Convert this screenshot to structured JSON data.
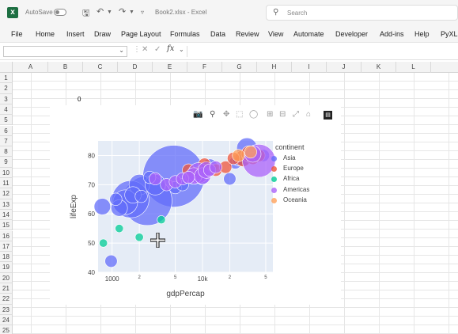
{
  "titlebar": {
    "autosave_label": "AutoSave",
    "toggle_state": "Off",
    "doc_title": "Book2.xlsx  -  Excel",
    "search_placeholder": "Search"
  },
  "ribbon": {
    "tabs": [
      "File",
      "Home",
      "Insert",
      "Draw",
      "Page Layout",
      "Formulas",
      "Data",
      "Review",
      "View",
      "Automate",
      "Developer",
      "Add-ins",
      "Help",
      "PyXLL"
    ]
  },
  "formula_bar": {
    "namebox_value": "",
    "fx_label": "fx",
    "formula_value": ""
  },
  "grid": {
    "columns": [
      "A",
      "B",
      "C",
      "D",
      "E",
      "F",
      "G",
      "H",
      "I",
      "J",
      "K",
      "L"
    ],
    "rows": [
      "1",
      "2",
      "3",
      "4",
      "5",
      "6",
      "7",
      "8",
      "9",
      "10",
      "11",
      "12",
      "13",
      "14",
      "15",
      "16",
      "17",
      "18",
      "19",
      "20",
      "21",
      "22",
      "23",
      "24",
      "25"
    ],
    "cell_B3": "0"
  },
  "modebar_icons": [
    "camera-icon",
    "zoom-icon",
    "pan-icon",
    "box-select-icon",
    "lasso-select-icon",
    "zoom-in-icon",
    "zoom-out-icon",
    "autoscale-icon",
    "reset-axes-icon",
    "plotly-logo-icon"
  ],
  "chart_data": {
    "type": "scatter",
    "xlabel": "gdpPercap",
    "ylabel": "lifeExp",
    "xscale": "log",
    "xlim": [
      700,
      60000
    ],
    "ylim": [
      40,
      85
    ],
    "x_ticks": [
      {
        "value": 1000,
        "label": "1000"
      },
      {
        "value": 2000,
        "label": "2"
      },
      {
        "value": 5000,
        "label": "5"
      },
      {
        "value": 10000,
        "label": "10k"
      },
      {
        "value": 20000,
        "label": "2"
      },
      {
        "value": 50000,
        "label": "5"
      }
    ],
    "y_ticks": [
      40,
      50,
      60,
      70,
      80
    ],
    "legend_title": "continent",
    "legend_position": "right",
    "series": [
      {
        "name": "Asia",
        "color": "#636efa",
        "points": [
          [
            975,
            43.8,
            3
          ],
          [
            780,
            62.5,
            4
          ],
          [
            1100,
            65,
            3
          ],
          [
            1200,
            62,
            4
          ],
          [
            1400,
            64,
            6
          ],
          [
            1600,
            65,
            9
          ],
          [
            1700,
            66.5,
            4
          ],
          [
            2000,
            70,
            5
          ],
          [
            2100,
            66,
            3
          ],
          [
            2450,
            64.5,
            12
          ],
          [
            2600,
            72.5,
            3
          ],
          [
            3000,
            70,
            5
          ],
          [
            4800,
            72.9,
            15
          ],
          [
            5000,
            69,
            3
          ],
          [
            6000,
            70,
            3
          ],
          [
            8000,
            73,
            4
          ],
          [
            10000,
            72,
            3
          ],
          [
            12000,
            76,
            4
          ],
          [
            20000,
            72,
            3
          ],
          [
            23000,
            77.5,
            3
          ],
          [
            25000,
            78.5,
            3
          ],
          [
            28000,
            78.5,
            3
          ],
          [
            31000,
            82.5,
            5
          ],
          [
            40000,
            80,
            3
          ],
          [
            47000,
            80,
            3
          ]
        ]
      },
      {
        "name": "Europe",
        "color": "#ef553b",
        "points": [
          [
            7000,
            75,
            3
          ],
          [
            9000,
            74,
            3
          ],
          [
            10500,
            77,
            3
          ],
          [
            14000,
            75,
            3
          ],
          [
            18000,
            76,
            3
          ],
          [
            22000,
            79,
            3
          ],
          [
            28000,
            79,
            4
          ],
          [
            33000,
            80.5,
            4
          ],
          [
            36000,
            79,
            3
          ],
          [
            42000,
            80,
            3
          ]
        ]
      },
      {
        "name": "Africa",
        "color": "#00cc96",
        "points": [
          [
            800,
            50,
            2
          ],
          [
            1200,
            55,
            2
          ],
          [
            2000,
            52,
            2
          ],
          [
            3500,
            58,
            2
          ]
        ]
      },
      {
        "name": "Americas",
        "color": "#ab63fa",
        "points": [
          [
            3000,
            72,
            3
          ],
          [
            4000,
            70,
            3
          ],
          [
            5000,
            71,
            3
          ],
          [
            6000,
            72,
            3
          ],
          [
            7000,
            72.5,
            3
          ],
          [
            8000,
            73,
            4
          ],
          [
            9000,
            74,
            5
          ],
          [
            10000,
            73,
            4
          ],
          [
            11000,
            75,
            4
          ],
          [
            12000,
            75,
            3
          ],
          [
            14000,
            76,
            3
          ],
          [
            36000,
            80.5,
            4
          ],
          [
            42000,
            78.2,
            8
          ]
        ]
      },
      {
        "name": "Oceania",
        "color": "#ffa15a",
        "points": [
          [
            25000,
            80,
            3
          ],
          [
            34000,
            81.2,
            3
          ]
        ]
      }
    ]
  }
}
